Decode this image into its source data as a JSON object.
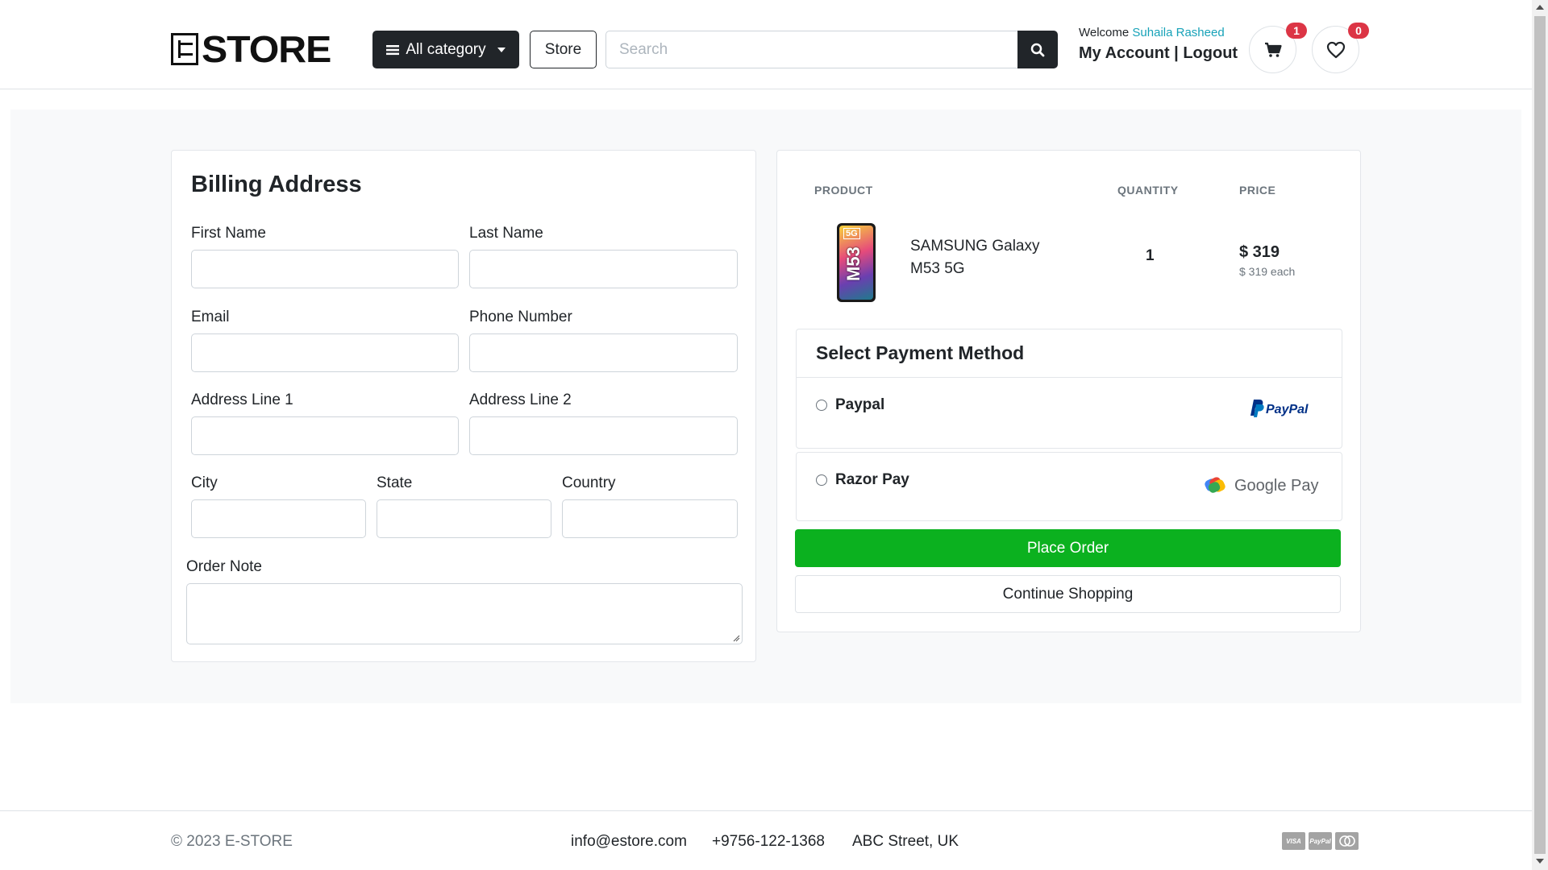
{
  "header": {
    "logo_text": "STORE",
    "logo_letter": "E",
    "all_category_label": "All category",
    "store_label": "Store",
    "search_placeholder": "Search",
    "welcome_prefix": "Welcome",
    "user_name": "Suhaila Rasheed",
    "my_account_label": "My Account",
    "separator": "|",
    "logout_label": "Logout",
    "cart_count": "1",
    "wishlist_count": "0"
  },
  "billing": {
    "title": "Billing Address",
    "first_name_label": "First Name",
    "last_name_label": "Last Name",
    "email_label": "Email",
    "phone_label": "Phone Number",
    "address1_label": "Address Line 1",
    "address2_label": "Address Line 2",
    "city_label": "City",
    "state_label": "State",
    "country_label": "Country",
    "order_note_label": "Order Note"
  },
  "order": {
    "columns": [
      "PRODUCT",
      "QUANTITY",
      "PRICE"
    ],
    "items": [
      {
        "name": "SAMSUNG Galaxy M53 5G",
        "image_text": "M53",
        "image_badge": "5G",
        "quantity": "1",
        "price": "$ 319",
        "price_each": "$ 319 each"
      }
    ],
    "payment_title": "Select Payment Method",
    "payment_methods": [
      {
        "label": "Paypal",
        "brand": "PayPal"
      },
      {
        "label": "Razor Pay",
        "brand": "Google Pay"
      }
    ],
    "place_order_label": "Place Order",
    "continue_label": "Continue Shopping"
  },
  "footer": {
    "copyright": "© 2023 E-STORE",
    "email": "info@estore.com",
    "phone": "+9756-122-1368",
    "address": "ABC Street, UK",
    "card_icons": [
      "VISA",
      "PayPal",
      "MC"
    ]
  },
  "colors": {
    "primary_dark": "#212529",
    "success": "#0bb11f",
    "badge": "#dc3545",
    "username": "#17a2b8",
    "section_bg": "#f8f9fa"
  }
}
